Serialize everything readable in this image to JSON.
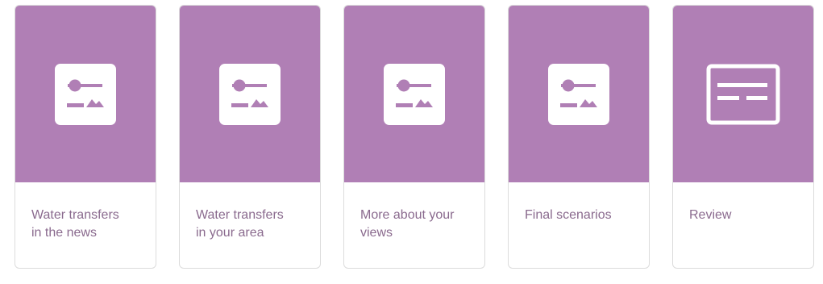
{
  "colors": {
    "accent": "#b07fb5",
    "label_text": "#8a6a8e",
    "border": "#dcdcdc"
  },
  "cards": [
    {
      "label": "Water transfers\nin the news",
      "icon": "slider-image-icon"
    },
    {
      "label": "Water transfers\nin your area",
      "icon": "slider-image-icon"
    },
    {
      "label": "More about your\nviews",
      "icon": "slider-image-icon"
    },
    {
      "label": "Final scenarios",
      "icon": "slider-image-icon"
    },
    {
      "label": "Review",
      "icon": "review-form-icon"
    }
  ]
}
